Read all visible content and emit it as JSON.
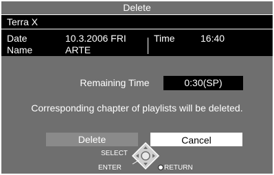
{
  "dialog": {
    "title": "Delete",
    "program_name": "Terra X",
    "date_label": "Date",
    "date_value": "10.3.2006 FRI",
    "time_label": "Time",
    "time_value": "16:40",
    "name_label": "Name",
    "name_value": "ARTE",
    "remaining_label": "Remaining Time",
    "remaining_value": "0:30(SP)",
    "message": "Corresponding chapter of playlists will be deleted."
  },
  "buttons": {
    "delete_label": "Delete",
    "cancel_label": "Cancel"
  },
  "guide": {
    "select_label": "SELECT",
    "enter_label": "ENTER",
    "return_label": "RETURN",
    "dpad_icon": "dpad-icon",
    "return_icon": "return-dot-icon"
  },
  "colors": {
    "panel_bg": "#6f6f6f",
    "info_bg": "#000000",
    "selected_button": "#8a8a8a",
    "button_bg": "#ffffff"
  }
}
